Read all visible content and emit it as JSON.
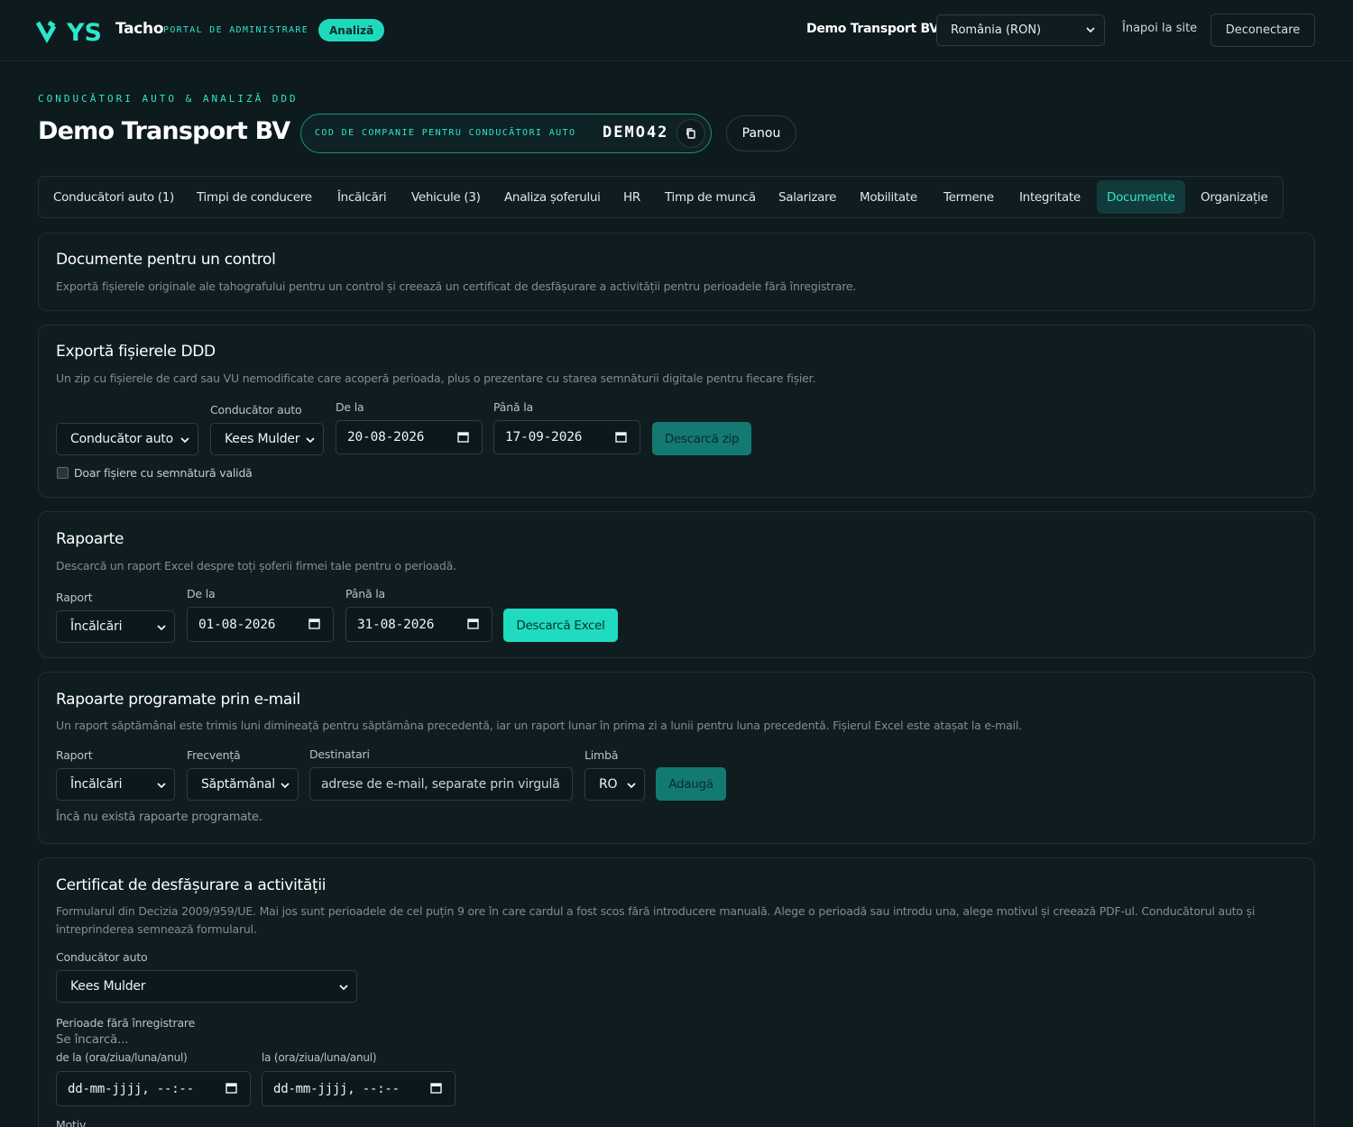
{
  "header": {
    "brand": "Tacho",
    "brand_sub": "PORTAL DE ADMINISTRARE",
    "badge": "Analiză",
    "company": "Demo Transport BV",
    "region_select": "România (RON)",
    "back_link": "Înapoi la site",
    "logout": "Deconectare"
  },
  "page": {
    "eyebrow": "CONDUCĂTORI AUTO & ANALIZĂ DDD",
    "title": "Demo Transport BV",
    "code_label": "COD DE COMPANIE PENTRU CONDUCĂTORI AUTO",
    "code_value": "DEMO42",
    "panel_button": "Panou"
  },
  "tabs": [
    {
      "label": "Conducători auto (1)"
    },
    {
      "label": "Timpi de conducere"
    },
    {
      "label": "Încălcări"
    },
    {
      "label": "Vehicule (3)"
    },
    {
      "label": "Analiza șoferului"
    },
    {
      "label": "HR"
    },
    {
      "label": "Timp de muncă"
    },
    {
      "label": "Salarizare"
    },
    {
      "label": "Mobilitate"
    },
    {
      "label": "Termene"
    },
    {
      "label": "Integritate"
    },
    {
      "label": "Documente"
    },
    {
      "label": "Organizație"
    }
  ],
  "active_tab": "Documente",
  "control_docs": {
    "title": "Documente pentru un control",
    "desc": "Exportă fișierele originale ale tahografului pentru un control și creează un certificat de desfășurare a activității pentru perioadele fără înregistrare."
  },
  "export_ddd": {
    "title": "Exportă fișierele DDD",
    "desc": "Un zip cu fișierele de card sau VU nemodificate care acoperă perioada, plus o prezentare cu starea semnăturii digitale pentru fiecare fișier.",
    "type_select": "Conducător auto",
    "driver_label": "Conducător auto",
    "driver_select": "Kees Mulder",
    "from_label": "De la",
    "from_value": "20-08-2026",
    "to_label": "Până la",
    "to_value": "17-09-2026",
    "download_button": "Descarcă zip",
    "checkbox_label": "Doar fișiere cu semnătură validă"
  },
  "reports": {
    "title": "Rapoarte",
    "desc": "Descarcă un raport Excel despre toți șoferii firmei tale pentru o perioadă.",
    "report_label": "Raport",
    "report_select": "Încălcări",
    "from_label": "De la",
    "from_value": "01-08-2026",
    "to_label": "Până la",
    "to_value": "31-08-2026",
    "download_button": "Descarcă Excel"
  },
  "scheduled": {
    "title": "Rapoarte programate prin e-mail",
    "desc": "Un raport săptămânal este trimis luni dimineață pentru săptămâna precedentă, iar un raport lunar în prima zi a lunii pentru luna precedentă. Fișierul Excel este atașat la e-mail.",
    "report_label": "Raport",
    "report_select": "Încălcări",
    "freq_label": "Frecvență",
    "freq_select": "Săptămânal",
    "recipients_label": "Destinatari",
    "recipients_placeholder": "adrese de e-mail, separate prin virgulă",
    "lang_label": "Limbă",
    "lang_select": "RO",
    "add_button": "Adaugă",
    "empty_note": "Încă nu există rapoarte programate."
  },
  "certificate": {
    "title": "Certificat de desfășurare a activității",
    "desc_line1": "Formularul din Decizia 2009/959/UE. Mai jos sunt perioadele de cel puțin 9 ore în care cardul a fost scos fără introducere manuală. Alege o perioadă sau introdu una, alege motivul și creează PDF-ul. Conducătorul auto și",
    "desc_line2": "întreprinderea semnează formularul.",
    "driver_label": "Conducător auto",
    "driver_select": "Kees Mulder",
    "periods_label": "Perioade fără înregistrare",
    "loading": "Se încarcă...",
    "from_label": "de la (ora/ziua/luna/anul)",
    "from_placeholder": "dd-mm-jjjj, --:--",
    "to_label": "la (ora/ziua/luna/anul)",
    "to_placeholder": "dd-mm-jjjj, --:--",
    "reason_label": "Motiv"
  },
  "colors": {
    "background": "#0d1a1e",
    "accent": "#2ee6c8",
    "card": "#0f1d21"
  }
}
